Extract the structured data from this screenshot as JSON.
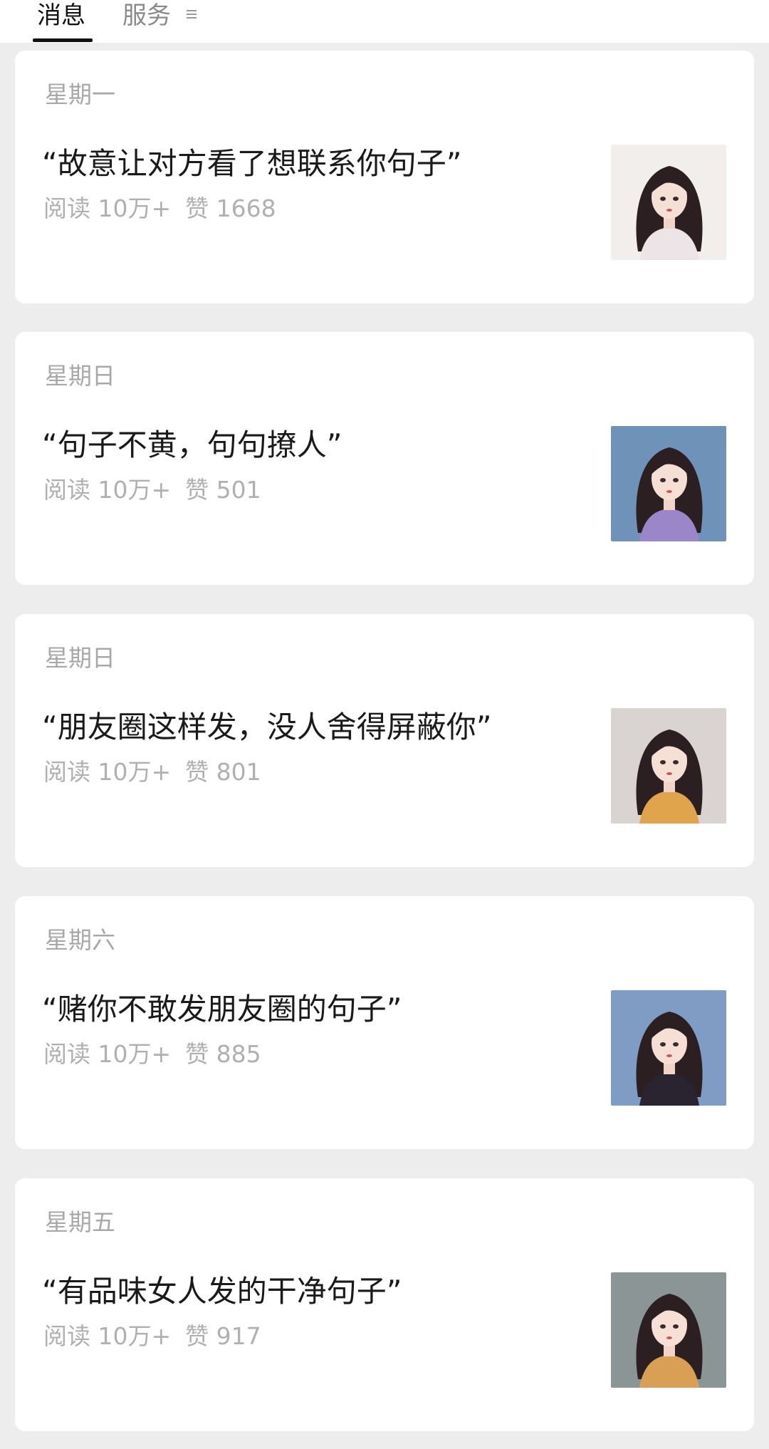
{
  "tabs": {
    "messages": "消息",
    "services": "服务"
  },
  "icons": {
    "menu": "menu-lines-icon"
  },
  "colors": {
    "background": "#ededed",
    "card": "#ffffff",
    "title": "#1a1a1a",
    "meta": "#a8a8a8"
  },
  "articles": [
    {
      "day": "星期一",
      "title": "“故意让对方看了想联系你句子”",
      "reads": "阅读 10万+",
      "likes": "赞 1668",
      "thumb_bg": "#f2eeec",
      "top_color": "#ede4e8"
    },
    {
      "day": "星期日",
      "title": "“句子不黄，句句撩人”",
      "reads": "阅读 10万+",
      "likes": "赞 501",
      "thumb_bg": "#6f93b8",
      "top_color": "#9a86c9"
    },
    {
      "day": "星期日",
      "title": "“朋友圈这样发，没人舍得屏蔽你”",
      "reads": "阅读 10万+",
      "likes": "赞 801",
      "thumb_bg": "#d9d3d2",
      "top_color": "#e0a54c"
    },
    {
      "day": "星期六",
      "title": "“赌你不敢发朋友圈的句子”",
      "reads": "阅读 10万+",
      "likes": "赞 885",
      "thumb_bg": "#7f9cc4",
      "top_color": "#2a2430"
    },
    {
      "day": "星期五",
      "title": "“有品味女人发的干净句子”",
      "reads": "阅读 10万+",
      "likes": "赞 917",
      "thumb_bg": "#8c9596",
      "top_color": "#d9a055"
    }
  ]
}
